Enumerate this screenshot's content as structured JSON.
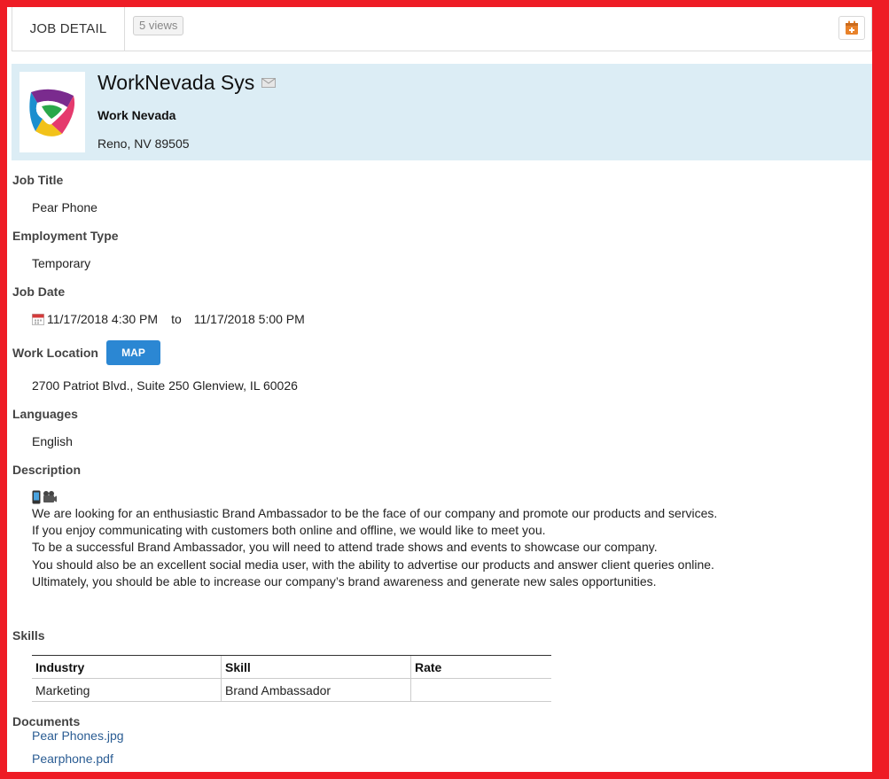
{
  "header": {
    "tab_label": "JOB DETAIL",
    "views_badge": "5 views",
    "calendar_icon": "calendar-plus-icon"
  },
  "company": {
    "name": "WorkNevada Sys",
    "subtitle": "Work Nevada",
    "location": "Reno, NV 89505",
    "mail_icon": "envelope-icon"
  },
  "job": {
    "title_label": "Job Title",
    "title_value": "Pear Phone",
    "type_label": "Employment Type",
    "type_value": "Temporary",
    "date_label": "Job Date",
    "date_start": "11/17/2018 4:30 PM",
    "date_to": "to",
    "date_end": "11/17/2018 5:00 PM",
    "location_label": "Work Location",
    "map_button": "MAP",
    "location_value": "2700 Patriot Blvd., Suite 250 Glenview, IL 60026",
    "languages_label": "Languages",
    "languages_value": "English",
    "description_label": "Description",
    "description_lines": [
      "We are looking for an enthusiastic Brand Ambassador to be the face of our company and promote our products and services.",
      "If you enjoy communicating with customers both online and offline, we would like to meet you.",
      "To be a successful Brand Ambassador, you will need to attend trade shows and events to showcase our company.",
      "You should also be an excellent social media user, with the ability to advertise our products and answer client queries online.",
      "Ultimately, you should be able to increase our company’s brand awareness and generate new sales opportunities."
    ]
  },
  "skills": {
    "label": "Skills",
    "columns": [
      "Industry",
      "Skill",
      "Rate"
    ],
    "rows": [
      [
        "Marketing",
        "Brand Ambassador",
        ""
      ]
    ]
  },
  "documents": {
    "label": "Documents",
    "files": [
      "Pear Phones.jpg",
      "Pearphone.pdf"
    ]
  },
  "colors": {
    "frame": "#ee1c25",
    "banner": "#dcedf5",
    "map_button": "#2b87d3",
    "link": "#2a5c93",
    "calendar_icon": "#e8822a"
  }
}
